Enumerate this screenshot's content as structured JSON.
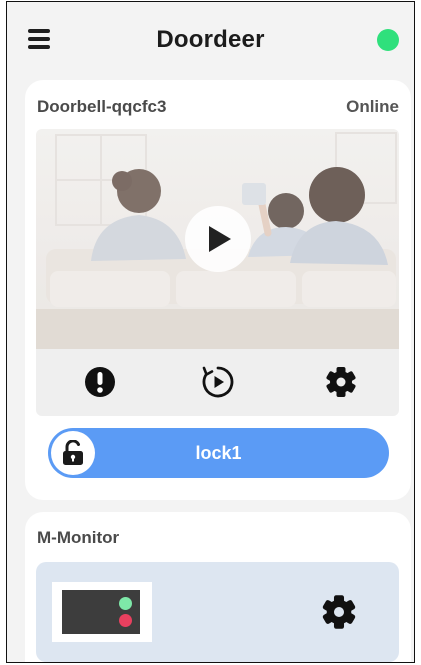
{
  "header": {
    "title": "Doordeer",
    "menu_icon": "hamburger-menu-icon",
    "status_color": "#2fe07c"
  },
  "devices": [
    {
      "name": "Doorbell-qqcfc3",
      "status": "Online",
      "preview_icon": "play-icon",
      "actions": [
        "alert-icon",
        "replay-icon",
        "settings-icon"
      ],
      "lock": {
        "label": "lock1",
        "icon": "unlocked-padlock-icon",
        "color": "#5b9bf5"
      }
    },
    {
      "name": "M-Monitor",
      "actions": [
        "settings-icon"
      ],
      "panel_color": "#dde6f1"
    }
  ]
}
